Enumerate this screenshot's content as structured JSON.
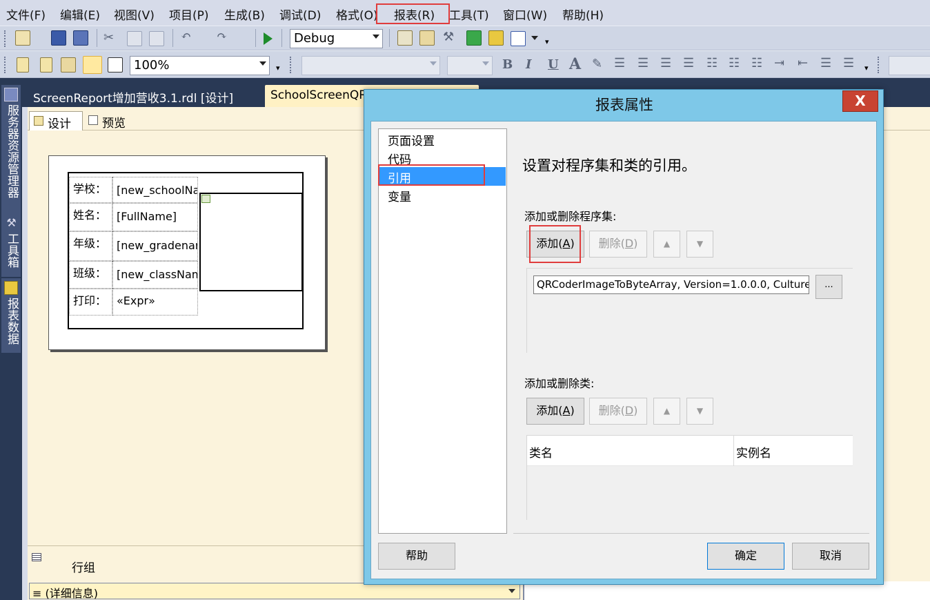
{
  "menu": {
    "items": [
      "文件(F)",
      "编辑(E)",
      "视图(V)",
      "项目(P)",
      "生成(B)",
      "调试(D)",
      "格式(O)",
      "报表(R)",
      "工具(T)",
      "窗口(W)",
      "帮助(H)"
    ]
  },
  "toolbar1": {
    "configuration": "Debug",
    "icons": [
      "new-project-icon",
      "save-icon",
      "save-all-icon",
      "cut-icon",
      "copy-icon",
      "paste-icon",
      "undo-icon",
      "redo-icon",
      "start-debug-icon",
      "find-icon",
      "properties-icon",
      "tools-icon",
      "import-icon",
      "layout-icon",
      "window-icon"
    ]
  },
  "toolbar2": {
    "zoom": "100%",
    "font_name": "",
    "font_size": "",
    "bold": "B",
    "italic": "I",
    "underline": "U",
    "icons": [
      "report-icon",
      "page-icon",
      "properties-icon",
      "grouping-icon",
      "ruler-icon",
      "font-color-icon",
      "highlight-icon",
      "align-left-icon",
      "align-center-icon",
      "align-right-icon",
      "numbered-list-icon",
      "bulleted-list-icon",
      "indent-icon",
      "outdent-icon"
    ]
  },
  "side_panels": [
    "服务器资源管理器",
    "工具箱",
    "报表数据"
  ],
  "doc_tabs": [
    {
      "label": "ScreenReport增加营收3.1.rdl [设计]"
    },
    {
      "label": "SchoolScreenQR"
    }
  ],
  "designer_tabs": {
    "design": "设计",
    "preview": "预览"
  },
  "report": {
    "rows": [
      {
        "label": "学校：",
        "value": "[new_schoolNam"
      },
      {
        "label": "姓名：",
        "value": "[FullName]"
      },
      {
        "label": "年级：",
        "value": "[new_gradename"
      },
      {
        "label": "班级：",
        "value": "[new_className"
      },
      {
        "label": "打印：",
        "value": "«Expr»"
      }
    ]
  },
  "grouping": {
    "row_groups_title": "行组",
    "detail_group": "≡ (详细信息)"
  },
  "dialog": {
    "title": "报表属性",
    "close_label": "X",
    "nav": [
      "页面设置",
      "代码",
      "引用",
      "变量"
    ],
    "selected_nav": "引用",
    "heading": "设置对程序集和类的引用。",
    "assemblies": {
      "title": "添加或删除程序集:",
      "add_label": "添加(",
      "add_key": "A",
      "remove_label": "删除(",
      "remove_key": "D",
      "close_paren": ")",
      "entry": "QRCoderImageToByteArray, Version=1.0.0.0, Culture",
      "browse_label": "..."
    },
    "classes": {
      "title": "添加或删除类:",
      "col_class": "类名",
      "col_instance": "实例名"
    },
    "help_label": "帮助",
    "ok_label": "确定",
    "cancel_label": "取消"
  },
  "colors": {
    "menubar": "#d6dbe9",
    "dark_frame": "#293955",
    "designer": "#fbf3dc",
    "dialog_frame": "#7ec8e8",
    "selection": "#3399ff",
    "close_button": "#c84332",
    "highlight": "#e03c3c"
  }
}
